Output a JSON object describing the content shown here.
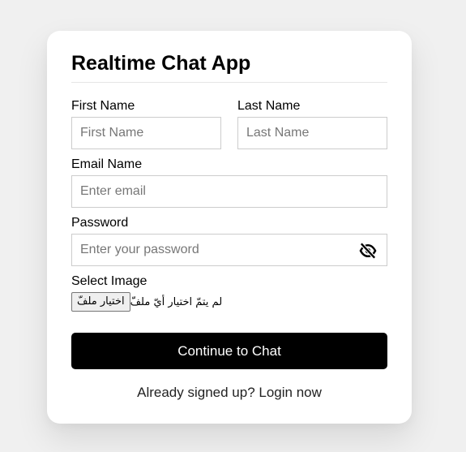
{
  "form": {
    "title": "Realtime Chat App",
    "first_name": {
      "label": "First Name",
      "placeholder": "First Name"
    },
    "last_name": {
      "label": "Last Name",
      "placeholder": "Last Name"
    },
    "email": {
      "label": "Email Name",
      "placeholder": "Enter email"
    },
    "password": {
      "label": "Password",
      "placeholder": "Enter your password",
      "toggle_icon": "eye-slash-icon"
    },
    "image": {
      "label": "Select Image",
      "button_label": "اختيار ملفّ",
      "status": "لم يتمّ اختيار أيّ ملفّ"
    },
    "submit_label": "Continue to Chat",
    "footer_text": "Already signed up? Login now"
  }
}
